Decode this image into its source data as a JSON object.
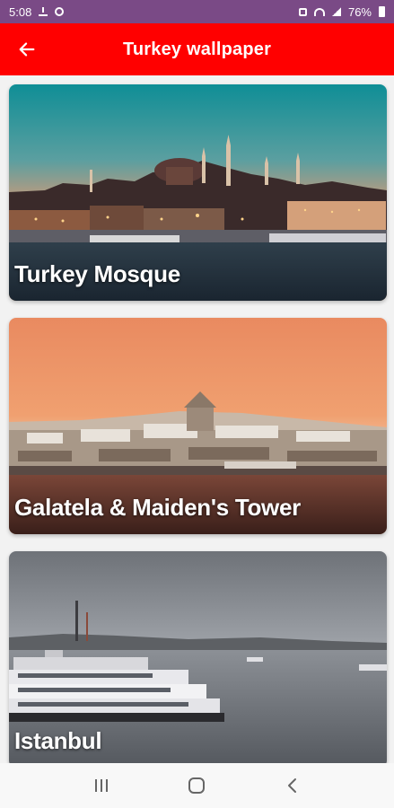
{
  "status_bar": {
    "time": "5:08",
    "battery": "76%",
    "left_icons": [
      "download-icon",
      "whatsapp-icon"
    ],
    "right_icons": [
      "mute-icon",
      "wifi-icon",
      "signal-icon",
      "battery-icon"
    ]
  },
  "app_bar": {
    "title": "Turkey wallpaper",
    "back_icon": "arrow-left-icon",
    "background": "#ff0000"
  },
  "cards": [
    {
      "label": "Turkey Mosque"
    },
    {
      "label": "Galatela & Maiden's Tower"
    },
    {
      "label": "Istanbul"
    }
  ],
  "nav_bar": {
    "items": [
      "recents-icon",
      "home-icon",
      "back-icon"
    ]
  }
}
